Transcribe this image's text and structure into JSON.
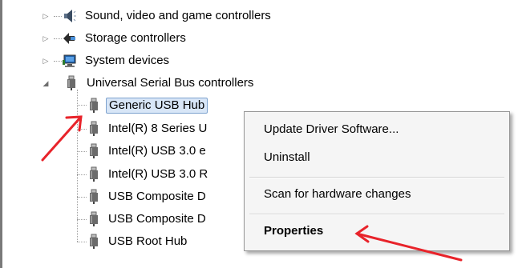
{
  "tree": {
    "sound": {
      "label": "Sound, video and game controllers",
      "icon": "speaker-icon",
      "expander": "▷"
    },
    "storage": {
      "label": "Storage controllers",
      "icon": "storage-controller-icon",
      "expander": "▷"
    },
    "system": {
      "label": "System devices",
      "icon": "computer-icon",
      "expander": "▷"
    },
    "usb": {
      "label": "Universal Serial Bus controllers",
      "icon": "usb-plug-icon",
      "expander": "◢",
      "children": [
        {
          "label": "Generic USB Hub",
          "icon": "usb-plug-icon"
        },
        {
          "label": "Intel(R) 8 Series U",
          "icon": "usb-plug-icon"
        },
        {
          "label": "Intel(R) USB 3.0 e",
          "icon": "usb-plug-icon"
        },
        {
          "label": "Intel(R) USB 3.0 R",
          "icon": "usb-plug-icon"
        },
        {
          "label": "USB Composite D",
          "icon": "usb-plug-icon"
        },
        {
          "label": "USB Composite D",
          "icon": "usb-plug-icon"
        },
        {
          "label": "USB Root Hub",
          "icon": "usb-plug-icon"
        }
      ]
    }
  },
  "context_menu": {
    "items": [
      {
        "label": "Update Driver Software..."
      },
      {
        "label": "Uninstall"
      },
      {
        "label": "Scan for hardware changes"
      },
      {
        "label": "Properties"
      }
    ]
  },
  "colors": {
    "selection_fill": "#d8e6f7",
    "selection_border": "#7da2ce",
    "annotation_arrow": "#e8232a",
    "menu_background": "#f5f5f5"
  }
}
